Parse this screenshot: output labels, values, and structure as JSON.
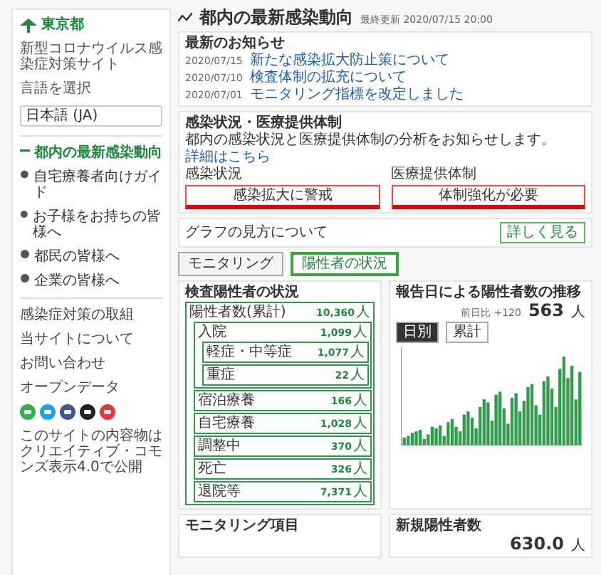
{
  "sidebar": {
    "site_name": "東京都",
    "subtitle": "新型コロナウイルス感染症対策サイト",
    "language_label": "言語を選択",
    "language": "日本語 (JA)",
    "nav": [
      {
        "label": "都内の最新感染動向",
        "selected": true
      },
      {
        "label": "自宅療養者向けガイド",
        "selected": false
      },
      {
        "label": "お子様をお持ちの皆様へ",
        "selected": false
      },
      {
        "label": "都民の皆様へ",
        "selected": false
      },
      {
        "label": "企業の皆様へ",
        "selected": false
      }
    ],
    "links": [
      "感染症対策の取組",
      "当サイトについて",
      "お問い合わせ",
      "オープンデータ"
    ],
    "footer": "このサイトの内容物はクリエイティブ・コモンズ表示4.0で公開"
  },
  "page": {
    "title": "都内の最新感染動向",
    "updated": "最終更新 2020/07/15 20:00"
  },
  "notices": {
    "title": "最新のお知らせ",
    "items": [
      {
        "date": "2020/07/15",
        "text": "新たな感染拡大防止策について"
      },
      {
        "date": "2020/07/10",
        "text": "検査体制の拡充について"
      },
      {
        "date": "2020/07/01",
        "text": "モニタリング指標を改定しました"
      }
    ]
  },
  "alert": {
    "title": "感染状況・医療提供体制",
    "body": "都内の感染状況と医療提供体制の分析をお知らせします。",
    "link": "詳細はこちら",
    "groups": [
      {
        "label": "感染状況",
        "button": "感染拡大に警戒"
      },
      {
        "label": "医療提供体制",
        "button": "体制強化が必要"
      }
    ]
  },
  "info_bar": {
    "text": "グラフの見方について",
    "button": "詳しく見る"
  },
  "tabs": [
    {
      "label": "モニタリング",
      "selected": false
    },
    {
      "label": "陽性者の状況",
      "selected": true
    }
  ],
  "positive_status": {
    "title": "検査陽性者の状況",
    "rows": [
      {
        "label": "陽性者数(累計)",
        "value": "10,360",
        "unit": "人",
        "children": [
          {
            "label": "入院",
            "value": "1,099",
            "unit": "人",
            "children": [
              {
                "label": "軽症・中等症",
                "value": "1,077",
                "unit": "人"
              },
              {
                "label": "重症",
                "value": "22",
                "unit": "人"
              }
            ]
          },
          {
            "label": "宿泊療養",
            "value": "166",
            "unit": "人"
          },
          {
            "label": "自宅療養",
            "value": "1,028",
            "unit": "人"
          },
          {
            "label": "調整中",
            "value": "370",
            "unit": "人"
          },
          {
            "label": "死亡",
            "value": "326",
            "unit": "人"
          },
          {
            "label": "退院等",
            "value": "7,371",
            "unit": "人"
          }
        ]
      }
    ]
  },
  "trend": {
    "title": "報告日による陽性者数の推移",
    "value": "563",
    "unit": "人",
    "note": "前日比 +120",
    "tabs": [
      {
        "label": "日別",
        "selected": true
      },
      {
        "label": "累計",
        "selected": false
      }
    ]
  },
  "bottom": [
    {
      "title": "モニタリング項目"
    },
    {
      "title": "新規陽性者数",
      "value": "630.0",
      "unit": "人"
    }
  ]
}
